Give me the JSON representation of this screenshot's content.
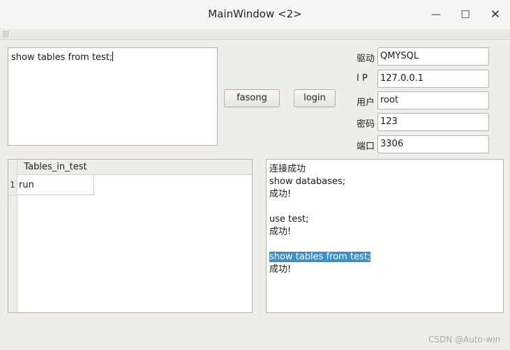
{
  "window": {
    "title": "MainWindow <2>",
    "min_glyph": "—",
    "max_glyph": "☐",
    "close_glyph": "✕"
  },
  "command": {
    "text": "show tables from test;"
  },
  "buttons": {
    "send": "fasong",
    "login": "login"
  },
  "connection": {
    "driver": {
      "label": "驱动",
      "value": "QMYSQL"
    },
    "ip": {
      "label": "I P",
      "value": "127.0.0.1"
    },
    "user": {
      "label": "用户",
      "value": "root"
    },
    "password": {
      "label": "密码",
      "value": "123"
    },
    "port": {
      "label": "端口",
      "value": "3306"
    }
  },
  "result_table": {
    "column": "Tables_in_test",
    "rows": [
      {
        "num": "1",
        "value": "run"
      }
    ]
  },
  "log": {
    "lines": [
      "连接成功",
      "show databases;",
      "成功!",
      "",
      "use test;",
      "成功!",
      "",
      "show tables from test;",
      "成功!"
    ],
    "selected_line_index": 7
  },
  "watermark": "CSDN @Auto-win",
  "colors": {
    "selection": "#3d8ec9",
    "background": "#efede9"
  }
}
